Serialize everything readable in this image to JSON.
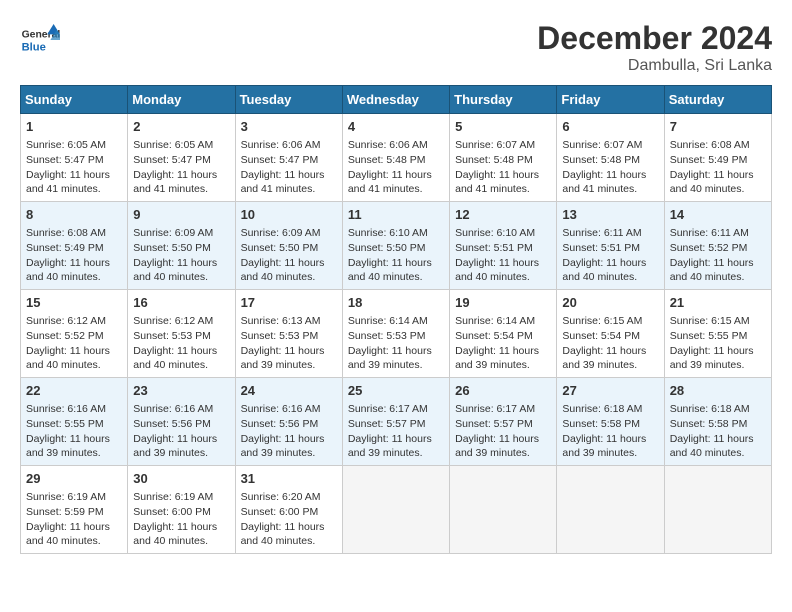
{
  "logo": {
    "general": "General",
    "blue": "Blue"
  },
  "title": "December 2024",
  "subtitle": "Dambulla, Sri Lanka",
  "days_of_week": [
    "Sunday",
    "Monday",
    "Tuesday",
    "Wednesday",
    "Thursday",
    "Friday",
    "Saturday"
  ],
  "weeks": [
    [
      {
        "day": 1,
        "sunrise": "6:05 AM",
        "sunset": "5:47 PM",
        "daylight": "11 hours and 41 minutes."
      },
      {
        "day": 2,
        "sunrise": "6:05 AM",
        "sunset": "5:47 PM",
        "daylight": "11 hours and 41 minutes."
      },
      {
        "day": 3,
        "sunrise": "6:06 AM",
        "sunset": "5:47 PM",
        "daylight": "11 hours and 41 minutes."
      },
      {
        "day": 4,
        "sunrise": "6:06 AM",
        "sunset": "5:48 PM",
        "daylight": "11 hours and 41 minutes."
      },
      {
        "day": 5,
        "sunrise": "6:07 AM",
        "sunset": "5:48 PM",
        "daylight": "11 hours and 41 minutes."
      },
      {
        "day": 6,
        "sunrise": "6:07 AM",
        "sunset": "5:48 PM",
        "daylight": "11 hours and 41 minutes."
      },
      {
        "day": 7,
        "sunrise": "6:08 AM",
        "sunset": "5:49 PM",
        "daylight": "11 hours and 40 minutes."
      }
    ],
    [
      {
        "day": 8,
        "sunrise": "6:08 AM",
        "sunset": "5:49 PM",
        "daylight": "11 hours and 40 minutes."
      },
      {
        "day": 9,
        "sunrise": "6:09 AM",
        "sunset": "5:50 PM",
        "daylight": "11 hours and 40 minutes."
      },
      {
        "day": 10,
        "sunrise": "6:09 AM",
        "sunset": "5:50 PM",
        "daylight": "11 hours and 40 minutes."
      },
      {
        "day": 11,
        "sunrise": "6:10 AM",
        "sunset": "5:50 PM",
        "daylight": "11 hours and 40 minutes."
      },
      {
        "day": 12,
        "sunrise": "6:10 AM",
        "sunset": "5:51 PM",
        "daylight": "11 hours and 40 minutes."
      },
      {
        "day": 13,
        "sunrise": "6:11 AM",
        "sunset": "5:51 PM",
        "daylight": "11 hours and 40 minutes."
      },
      {
        "day": 14,
        "sunrise": "6:11 AM",
        "sunset": "5:52 PM",
        "daylight": "11 hours and 40 minutes."
      }
    ],
    [
      {
        "day": 15,
        "sunrise": "6:12 AM",
        "sunset": "5:52 PM",
        "daylight": "11 hours and 40 minutes."
      },
      {
        "day": 16,
        "sunrise": "6:12 AM",
        "sunset": "5:53 PM",
        "daylight": "11 hours and 40 minutes."
      },
      {
        "day": 17,
        "sunrise": "6:13 AM",
        "sunset": "5:53 PM",
        "daylight": "11 hours and 39 minutes."
      },
      {
        "day": 18,
        "sunrise": "6:14 AM",
        "sunset": "5:53 PM",
        "daylight": "11 hours and 39 minutes."
      },
      {
        "day": 19,
        "sunrise": "6:14 AM",
        "sunset": "5:54 PM",
        "daylight": "11 hours and 39 minutes."
      },
      {
        "day": 20,
        "sunrise": "6:15 AM",
        "sunset": "5:54 PM",
        "daylight": "11 hours and 39 minutes."
      },
      {
        "day": 21,
        "sunrise": "6:15 AM",
        "sunset": "5:55 PM",
        "daylight": "11 hours and 39 minutes."
      }
    ],
    [
      {
        "day": 22,
        "sunrise": "6:16 AM",
        "sunset": "5:55 PM",
        "daylight": "11 hours and 39 minutes."
      },
      {
        "day": 23,
        "sunrise": "6:16 AM",
        "sunset": "5:56 PM",
        "daylight": "11 hours and 39 minutes."
      },
      {
        "day": 24,
        "sunrise": "6:16 AM",
        "sunset": "5:56 PM",
        "daylight": "11 hours and 39 minutes."
      },
      {
        "day": 25,
        "sunrise": "6:17 AM",
        "sunset": "5:57 PM",
        "daylight": "11 hours and 39 minutes."
      },
      {
        "day": 26,
        "sunrise": "6:17 AM",
        "sunset": "5:57 PM",
        "daylight": "11 hours and 39 minutes."
      },
      {
        "day": 27,
        "sunrise": "6:18 AM",
        "sunset": "5:58 PM",
        "daylight": "11 hours and 39 minutes."
      },
      {
        "day": 28,
        "sunrise": "6:18 AM",
        "sunset": "5:58 PM",
        "daylight": "11 hours and 40 minutes."
      }
    ],
    [
      {
        "day": 29,
        "sunrise": "6:19 AM",
        "sunset": "5:59 PM",
        "daylight": "11 hours and 40 minutes."
      },
      {
        "day": 30,
        "sunrise": "6:19 AM",
        "sunset": "6:00 PM",
        "daylight": "11 hours and 40 minutes."
      },
      {
        "day": 31,
        "sunrise": "6:20 AM",
        "sunset": "6:00 PM",
        "daylight": "11 hours and 40 minutes."
      },
      null,
      null,
      null,
      null
    ]
  ]
}
